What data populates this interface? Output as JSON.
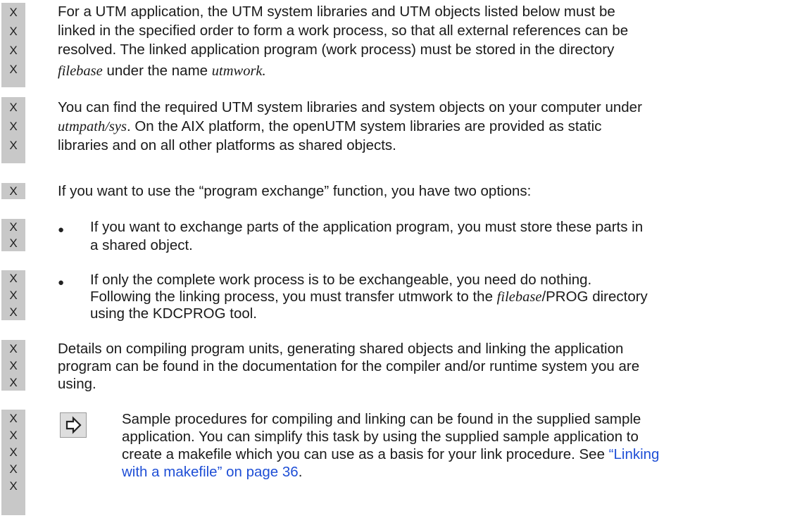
{
  "marker": "X",
  "colors": {
    "change_bar": "#c8c8c8",
    "link": "#1f4fd6"
  },
  "p1": {
    "line1": "For a UTM application, the UTM system libraries and UTM objects listed below must be",
    "line2": "linked in the specified order to form a work process, so that all external references can be",
    "line3": "resolved. The linked application program (work process) must be stored in the directory",
    "line4_em1": "filebase",
    "line4_mid": " under the name ",
    "line4_em2": "utmwork",
    "line4_end": "."
  },
  "p2": {
    "line1": "You can find the required UTM system libraries and system objects on your computer under",
    "line2_em": "utmpath/sys",
    "line2_rest": ". On the AIX platform, the openUTM system libraries are provided as static",
    "line3": "libraries and on all other platforms as shared objects."
  },
  "p3": {
    "line1": "If you want to use the “program exchange” function, you have two options:"
  },
  "bullet_symbol": "●",
  "b1": {
    "line1": "If you want to exchange parts of the application program, you must store these parts in",
    "line2": "a shared object."
  },
  "b2": {
    "line1": "If only the complete work process is to be exchangeable, you need do nothing.",
    "line2_a": "Following the linking process, you must transfer utmwork to the ",
    "line2_em": "filebase",
    "line2_b": "/PROG directory",
    "line3": "using the KDCPROG tool."
  },
  "p4": {
    "line1": "Details on compiling program units, generating shared objects and linking the application",
    "line2": "program can be found in the documentation for the compiler and/or runtime system you are",
    "line3": "using."
  },
  "note": {
    "icon": "arrow-right-icon",
    "line1": "Sample procedures for compiling and linking can be found in the supplied sample",
    "line2": "application. You can simplify this task by using the supplied sample application to",
    "line3_a": "create a makefile which you can use as a basis for your link procedure. See ",
    "line3_link": "“Linking",
    "line4_link": "with a makefile” on page 36",
    "line4_end": "."
  }
}
